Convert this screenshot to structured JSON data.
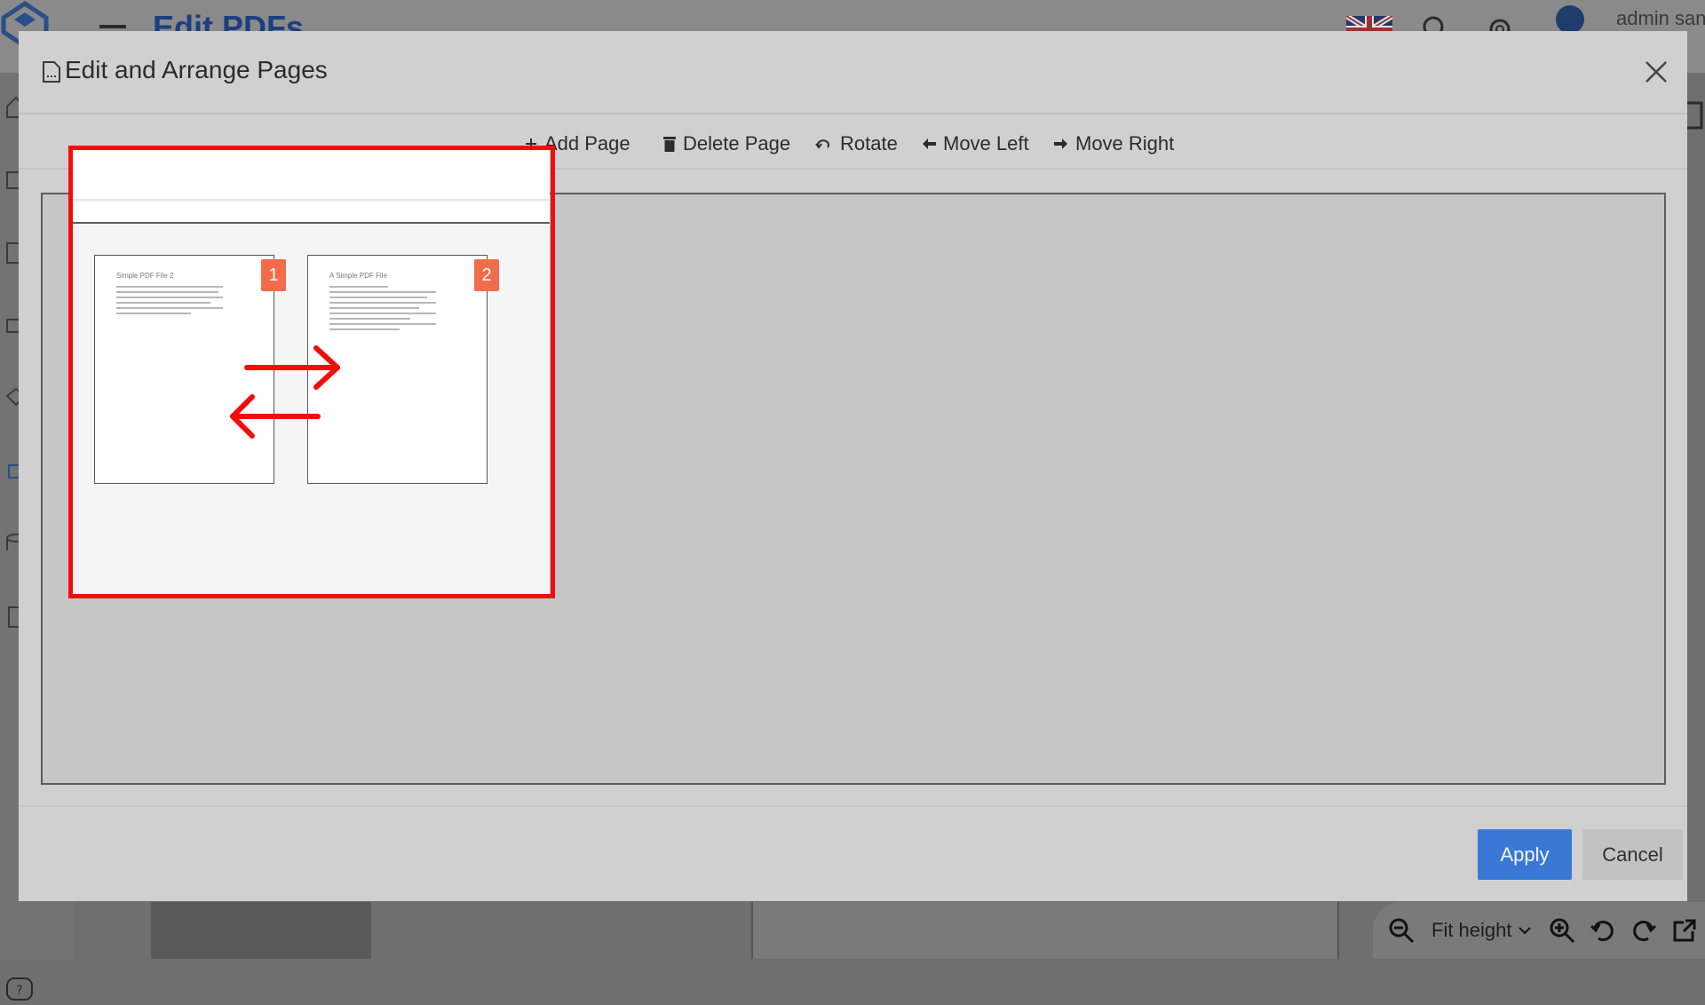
{
  "app": {
    "title": "Edit PDFs",
    "user": "admin san"
  },
  "modal": {
    "title": "Edit and Arrange Pages",
    "toolbar": {
      "add_page": "Add Page",
      "delete_page": "Delete Page",
      "rotate": "Rotate",
      "move_left": "Move Left",
      "move_right": "Move Right"
    },
    "pages": [
      {
        "badge": "1",
        "title": "Simple PDF File 2"
      },
      {
        "badge": "2",
        "title": "A Simple PDF File"
      }
    ],
    "apply_label": "Apply",
    "cancel_label": "Cancel"
  },
  "viewer_toolbar": {
    "zoom_mode": "Fit height"
  },
  "colors": {
    "highlight": "#f20d0d",
    "badge": "#f26b4a",
    "apply": "#3a78d6",
    "swap_arrows": "#f20d0d"
  },
  "icons": [
    "logo-icon",
    "menu-icon",
    "uk-flag-icon",
    "search-icon",
    "gear-icon",
    "file-icon",
    "close-icon",
    "plus-icon",
    "trash-icon",
    "rotate-icon",
    "arrow-left-icon",
    "arrow-right-icon",
    "swap-arrows-icon",
    "zoom-out-icon",
    "chevron-down-icon",
    "zoom-in-icon",
    "rotate-left-icon",
    "rotate-right-icon",
    "external-link-icon",
    "help-icon"
  ]
}
